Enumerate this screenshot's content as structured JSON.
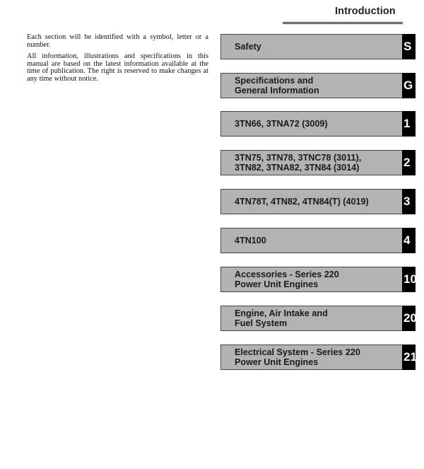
{
  "header": {
    "title": "Introduction"
  },
  "intro": {
    "paragraphs": [
      "Each section will be identified with a symbol, letter or a number.",
      "All information, illustrations and specifications in this manual are based on the latest information available at the time of publication. The right is reserved to make changes at any time without notice."
    ]
  },
  "sections": [
    {
      "label": "Safety",
      "marker": "S"
    },
    {
      "label": "Specifications and\nGeneral Information",
      "marker": "G"
    },
    {
      "label": "3TN66, 3TNA72 (3009)",
      "marker": "1"
    },
    {
      "label": "3TN75, 3TN78, 3TNC78 (3011),\n3TN82, 3TNA82, 3TN84 (3014)",
      "marker": "2"
    },
    {
      "label": "4TN78T, 4TN82, 4TN84(T) (4019)",
      "marker": "3"
    },
    {
      "label": "4TN100",
      "marker": "4"
    },
    {
      "label": "Accessories - Series 220\nPower Unit Engines",
      "marker": "10"
    },
    {
      "label": "Engine, Air Intake and\nFuel System",
      "marker": "20"
    },
    {
      "label": "Electrical System - Series 220\nPower Unit Engines",
      "marker": "21"
    }
  ]
}
